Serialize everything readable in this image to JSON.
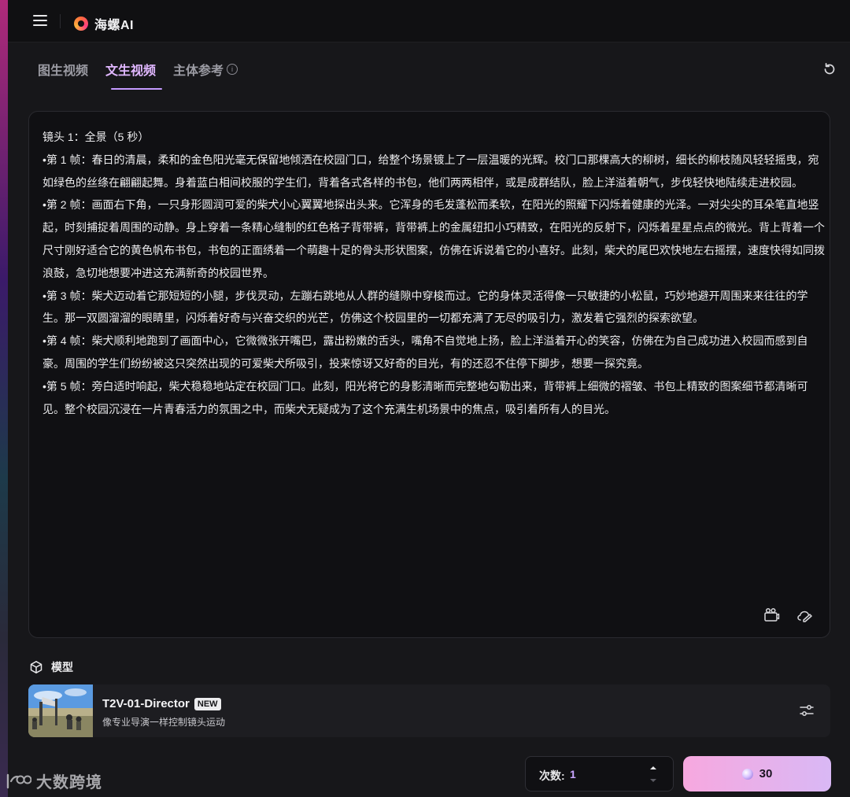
{
  "app": {
    "name": "海螺AI"
  },
  "tabs": [
    {
      "label": "图生视频",
      "active": false
    },
    {
      "label": "文生视频",
      "active": true
    },
    {
      "label": "主体参考",
      "active": false
    }
  ],
  "prompt": {
    "text": "镜头 1：全景（5 秒）\n•第 1 帧：春日的清晨，柔和的金色阳光毫无保留地倾洒在校园门口，给整个场景镀上了一层温暖的光辉。校门口那棵高大的柳树，细长的柳枝随风轻轻摇曳，宛如绿色的丝绦在翩翩起舞。身着蓝白相间校服的学生们，背着各式各样的书包，他们两两相伴，或是成群结队，脸上洋溢着朝气，步伐轻快地陆续走进校园。\n•第 2 帧：画面右下角，一只身形圆润可爱的柴犬小心翼翼地探出头来。它浑身的毛发蓬松而柔软，在阳光的照耀下闪烁着健康的光泽。一对尖尖的耳朵笔直地竖起，时刻捕捉着周围的动静。身上穿着一条精心缝制的红色格子背带裤，背带裤上的金属纽扣小巧精致，在阳光的反射下，闪烁着星星点点的微光。背上背着一个尺寸刚好适合它的黄色帆布书包，书包的正面绣着一个萌趣十足的骨头形状图案，仿佛在诉说着它的小喜好。此刻，柴犬的尾巴欢快地左右摇摆，速度快得如同拨浪鼓，急切地想要冲进这充满新奇的校园世界。\n•第 3 帧：柴犬迈动着它那短短的小腿，步伐灵动，左蹦右跳地从人群的缝隙中穿梭而过。它的身体灵活得像一只敏捷的小松鼠，巧妙地避开周围来来往往的学生。那一双圆溜溜的眼睛里，闪烁着好奇与兴奋交织的光芒，仿佛这个校园里的一切都充满了无尽的吸引力，激发着它强烈的探索欲望。\n•第 4 帧：柴犬顺利地跑到了画面中心，它微微张开嘴巴，露出粉嫩的舌头，嘴角不自觉地上扬，脸上洋溢着开心的笑容，仿佛在为自己成功进入校园而感到自豪。周围的学生们纷纷被这只突然出现的可爱柴犬所吸引，投来惊讶又好奇的目光，有的还忍不住停下脚步，想要一探究竟。\n•第 5 帧：旁白适时响起，柴犬稳稳地站定在校园门口。此刻，阳光将它的身影清晰而完整地勾勒出来，背带裤上细微的褶皱、书包上精致的图案细节都清晰可见。整个校园沉浸在一片青春活力的氛围之中，而柴犬无疑成为了这个充满生机场景中的焦点，吸引着所有人的目光。"
  },
  "model_section": {
    "label": "模型",
    "model_name": "T2V-01-Director",
    "badge": "NEW",
    "description": "像专业导演一样控制镜头运动"
  },
  "controls": {
    "count_label": "次数:",
    "count_value": "1",
    "generate_credits": "30"
  },
  "watermark": {
    "text": "大数跨境"
  },
  "colors": {
    "accent": "#c59bff",
    "generate_gradient_start": "#f7a8df",
    "generate_gradient_end": "#d9b8f5",
    "background": "#17171a"
  }
}
